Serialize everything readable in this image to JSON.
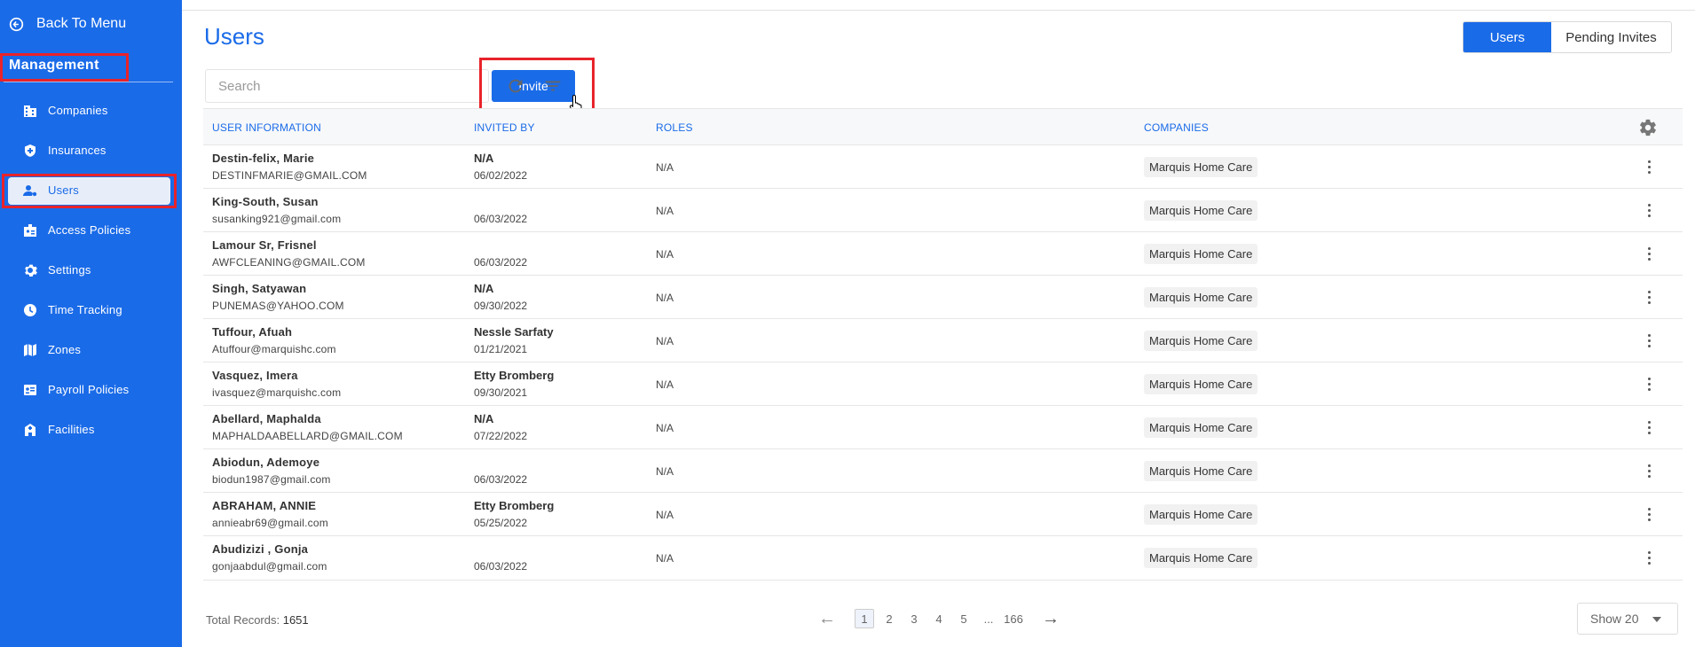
{
  "sidebar": {
    "back_label": "Back To Menu",
    "section_title": "Management",
    "items": [
      {
        "label": "Companies",
        "icon": "building-icon"
      },
      {
        "label": "Insurances",
        "icon": "shield-plus-icon"
      },
      {
        "label": "Users",
        "icon": "users-gear-icon"
      },
      {
        "label": "Access Policies",
        "icon": "badge-icon"
      },
      {
        "label": "Settings",
        "icon": "gear-icon"
      },
      {
        "label": "Time Tracking",
        "icon": "clock-icon"
      },
      {
        "label": "Zones",
        "icon": "map-icon"
      },
      {
        "label": "Payroll Policies",
        "icon": "id-card-icon"
      },
      {
        "label": "Facilities",
        "icon": "facility-icon"
      }
    ],
    "active": "Users"
  },
  "header": {
    "title": "Users",
    "tabs": [
      "Users",
      "Pending Invites"
    ]
  },
  "toolbar": {
    "search_placeholder": "Search",
    "invite_label": "Invite"
  },
  "table": {
    "headers": [
      "USER INFORMATION",
      "INVITED BY",
      "ROLES",
      "COMPANIES"
    ],
    "rows": [
      {
        "name": "Destin-felix, Marie",
        "email": "DESTINFMARIE@GMAIL.COM",
        "invited_by": "N/A",
        "date": "06/02/2022",
        "roles": "N/A",
        "company": "Marquis Home Care"
      },
      {
        "name": "King-South, Susan",
        "email": "susanking921@gmail.com",
        "invited_by": "",
        "date": "06/03/2022",
        "roles": "N/A",
        "company": "Marquis Home Care"
      },
      {
        "name": "Lamour Sr, Frisnel",
        "email": "AWFCLEANING@GMAIL.COM",
        "invited_by": "",
        "date": "06/03/2022",
        "roles": "N/A",
        "company": "Marquis Home Care"
      },
      {
        "name": "Singh, Satyawan",
        "email": "PUNEMAS@YAHOO.COM",
        "invited_by": "N/A",
        "date": "09/30/2022",
        "roles": "N/A",
        "company": "Marquis Home Care"
      },
      {
        "name": "Tuffour, Afuah",
        "email": "Atuffour@marquishc.com",
        "invited_by": "Nessle Sarfaty",
        "date": "01/21/2021",
        "roles": "N/A",
        "company": "Marquis Home Care"
      },
      {
        "name": "Vasquez, Imera",
        "email": "ivasquez@marquishc.com",
        "invited_by": "Etty Bromberg",
        "date": "09/30/2021",
        "roles": "N/A",
        "company": "Marquis Home Care"
      },
      {
        "name": "Abellard, Maphalda",
        "email": "MAPHALDAABELLARD@GMAIL.COM",
        "invited_by": "N/A",
        "date": "07/22/2022",
        "roles": "N/A",
        "company": "Marquis Home Care"
      },
      {
        "name": "Abiodun, Ademoye",
        "email": "biodun1987@gmail.com",
        "invited_by": "",
        "date": "06/03/2022",
        "roles": "N/A",
        "company": "Marquis Home Care"
      },
      {
        "name": "ABRAHAM, ANNIE",
        "email": "annieabr69@gmail.com",
        "invited_by": "Etty Bromberg",
        "date": "05/25/2022",
        "roles": "N/A",
        "company": "Marquis Home Care"
      },
      {
        "name": "Abudizizi , Gonja",
        "email": "gonjaabdul@gmail.com",
        "invited_by": "",
        "date": "06/03/2022",
        "roles": "N/A",
        "company": "Marquis Home Care"
      }
    ]
  },
  "footer": {
    "total_label": "Total Records:",
    "total_value": "1651",
    "pages": [
      "1",
      "2",
      "3",
      "4",
      "5",
      "...",
      "166"
    ],
    "current_page": "1",
    "page_size": "Show 20"
  },
  "colors": {
    "primary": "#1a6be8",
    "highlight": "#e8232a"
  }
}
